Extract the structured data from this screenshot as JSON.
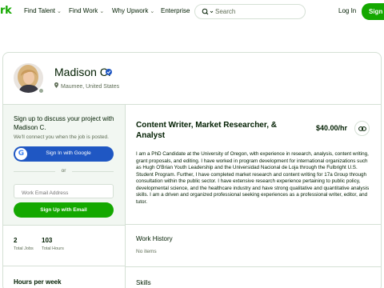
{
  "nav": {
    "logo": "rk",
    "items": [
      {
        "label": "Find Talent",
        "has_dropdown": true
      },
      {
        "label": "Find Work",
        "has_dropdown": true
      },
      {
        "label": "Why Upwork",
        "has_dropdown": true
      },
      {
        "label": "Enterprise",
        "has_dropdown": false
      }
    ],
    "search_placeholder": "Search",
    "login": "Log In",
    "signup": "Sign Up"
  },
  "profile": {
    "name": "Madison C.",
    "verified": true,
    "location": "Maumee, United States",
    "online_status": "offline"
  },
  "signup_panel": {
    "title": "Sign up to discuss your project with Madison C.",
    "subtitle": "We'll connect you when the job is posted.",
    "google_button": "Sign In with Google",
    "divider_text": "or",
    "email_placeholder": "Work Email Address",
    "email_button": "Sign Up with Email"
  },
  "stats": {
    "total_jobs_value": "2",
    "total_jobs_label": "Total Jobs",
    "total_hours_value": "103",
    "total_hours_label": "Total Hours"
  },
  "hours_per_week_title": "Hours per week",
  "overview": {
    "title": "Content Writer, Market Researcher, & Analyst",
    "rate": "$40.00/hr",
    "bio": "I am a PhD Candidate at the University of Oregon, with experience in research, analysis, content writing, grant proposals, and editing. I have worked in program development for international organizations such as Hugh O'Brian Youth Leadership and the Universidad Nacional de Loja through the Fulbright U.S. Student Program. Further, I have completed market research and content writing for 17a Group through consultation within the public sector. I have extensive research experience pertaining to public policy, developmental science, and the healthcare industry and have strong qualitative and quantitative analysis skills. I am a driven and organized professional seeking experiences as a professional writer, editor, and tutor."
  },
  "work_history": {
    "title": "Work History",
    "empty_text": "No items"
  },
  "skills": {
    "title": "Skills"
  },
  "colors": {
    "brand_green": "#14a800",
    "google_blue": "#1f57c3",
    "text": "#001e00",
    "muted": "#5e6d55",
    "border": "#d5e0d5",
    "panel_bg": "#f2f7f2"
  }
}
